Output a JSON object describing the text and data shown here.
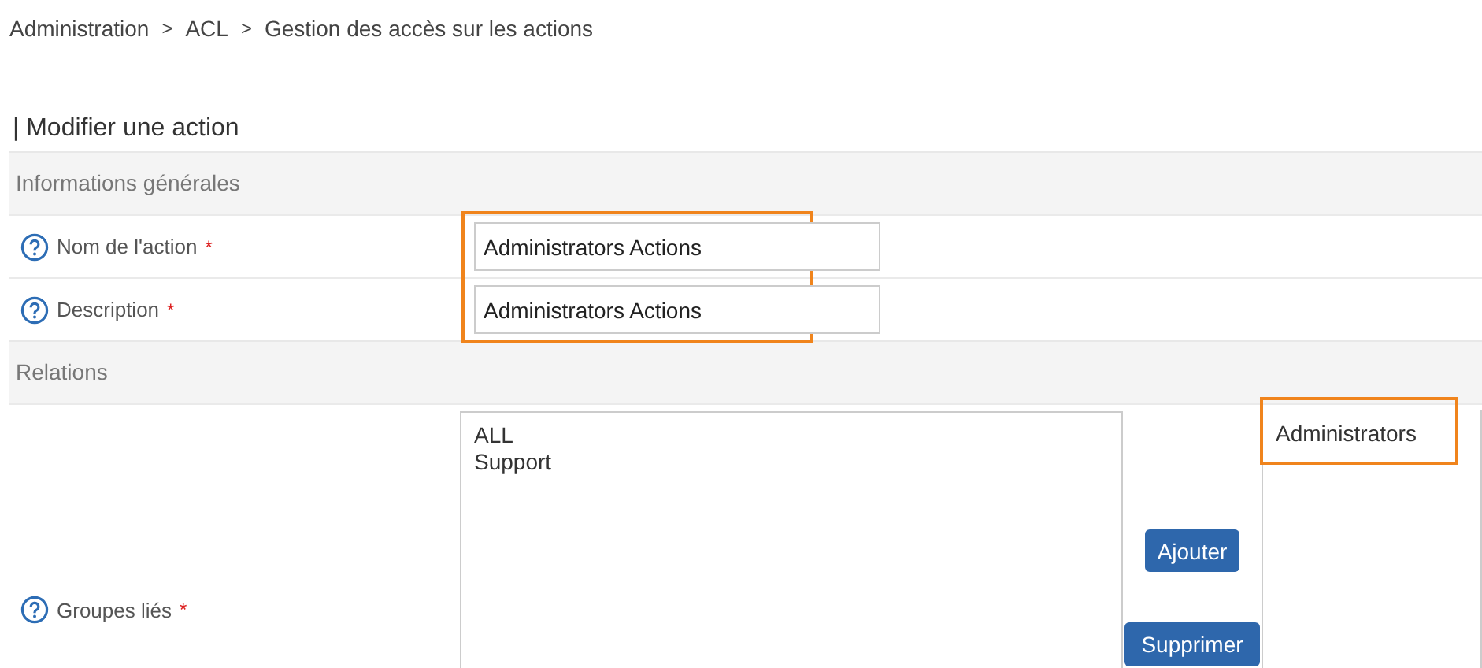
{
  "breadcrumb": [
    "Administration",
    "ACL",
    "Gestion des accès sur les actions"
  ],
  "breadcrumb_separator": ">",
  "required_mark": "*",
  "title": "| Modifier une action",
  "sections": [
    {
      "heading": "Informations générales",
      "fields": [
        {
          "kind": "text",
          "label": "Nom de l'action",
          "required": true,
          "value": "Administrators Actions",
          "highlighted": true
        },
        {
          "kind": "text",
          "label": "Description",
          "required": true,
          "value": "Administrators Actions",
          "highlighted": true
        }
      ]
    },
    {
      "heading": "Relations",
      "fields": [
        {
          "kind": "dual_list",
          "label": "Groupes liés",
          "required": true,
          "available": [
            "ALL",
            "Support"
          ],
          "buttons": [
            "Ajouter",
            "Supprimer"
          ],
          "chosen": [
            "Administrators"
          ],
          "chosen_highlighted": true
        }
      ]
    }
  ]
}
